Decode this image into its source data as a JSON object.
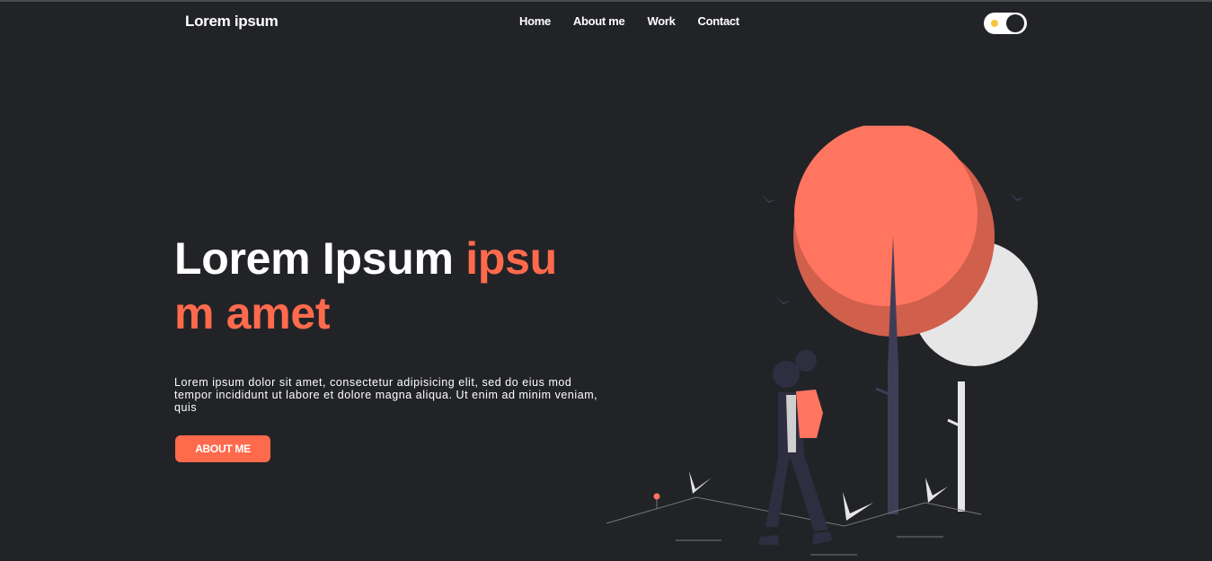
{
  "header": {
    "brand": "Lorem ipsum",
    "nav": [
      "Home",
      "About me",
      "Work",
      "Contact"
    ],
    "theme_toggle": {
      "state": "dark",
      "icon": "sun-icon"
    }
  },
  "hero": {
    "title_main": "Lorem Ipsum",
    "title_accent": "ipsum amet",
    "description": "Lorem ipsum dolor sit amet, consectetur adipisicing elit, sed do eius mod tempor incididunt ut labore et dolore magna aliqua. Ut enim ad minim veniam, quis",
    "button_label": "ABOUT ME"
  },
  "colors": {
    "background": "#222327",
    "accent": "#ff6a4d",
    "text": "#ffffff"
  }
}
